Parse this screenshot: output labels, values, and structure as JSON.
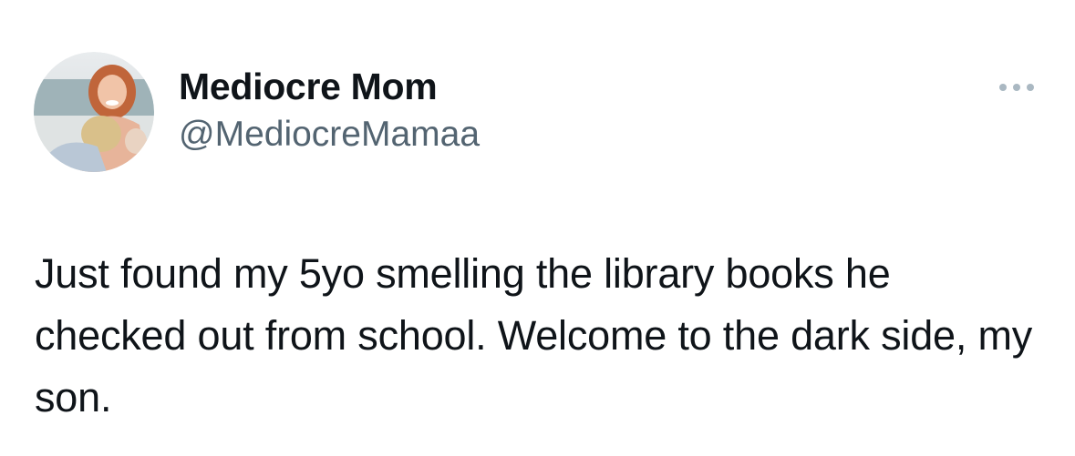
{
  "author": {
    "display_name": "Mediocre Mom",
    "handle": "@MediocreMamaa"
  },
  "more_icon": "more-horizontal-icon",
  "tweet": {
    "text": "Just found my 5yo smelling the library books he checked out from school. Welcome to the dark side, my son."
  },
  "colors": {
    "text_primary": "#0f1419",
    "text_secondary": "#536471",
    "more_icon": "#aab8c2"
  }
}
